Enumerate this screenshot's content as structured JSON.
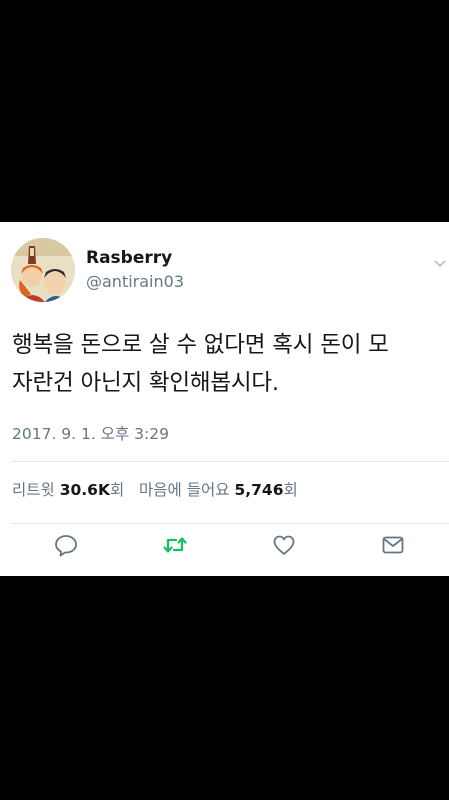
{
  "tweet": {
    "user": {
      "display_name": "Rasberry",
      "handle": "@antirain03"
    },
    "text_line1": "행복을 돈으로 살 수 없다면 혹시 돈이 모",
    "text_line2": "자란건 아닌지 확인해봅시다.",
    "timestamp": "2017. 9. 1. 오후 3:29",
    "stats": {
      "retweet_label": "리트윗",
      "retweet_count": "30.6K",
      "retweet_unit": "회",
      "like_label": "마음에 들어요",
      "like_count": "5,746",
      "like_unit": "회"
    },
    "actions": [
      "reply-icon",
      "retweet-icon",
      "like-icon",
      "message-icon"
    ],
    "colors": {
      "retweet_green": "#17bf63",
      "icon_gray": "#657786",
      "text": "#14171a",
      "divider": "#e1e8ed"
    }
  }
}
